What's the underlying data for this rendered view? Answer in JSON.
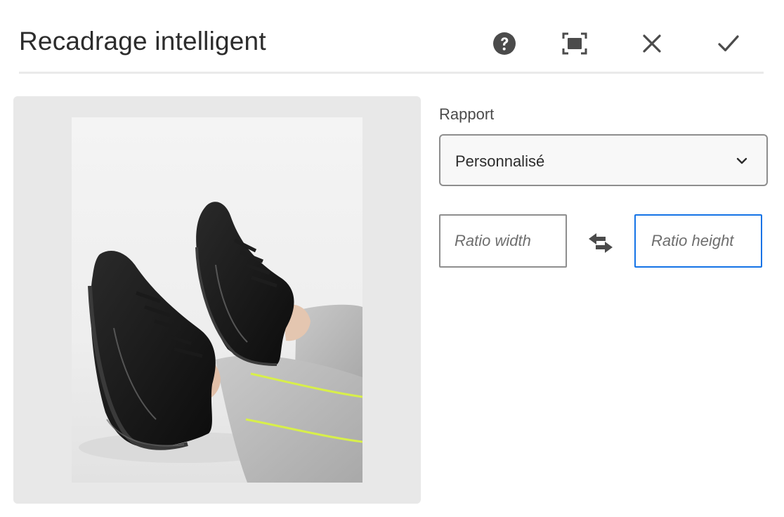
{
  "dialog": {
    "title": "Recadrage intelligent",
    "actions": {
      "help_icon": "help-circle-icon",
      "fullscreen_icon": "fullscreen-icon",
      "close_icon": "close-icon",
      "done_icon": "checkmark-icon"
    }
  },
  "preview": {
    "image_subject": "black-sneakers-photo"
  },
  "ratio": {
    "label": "Rapport",
    "selected": "Personnalisé",
    "width_placeholder": "Ratio width",
    "height_placeholder": "Ratio height",
    "width_value": "",
    "height_value": "",
    "swap_icon": "swap-arrows-icon"
  },
  "colors": {
    "accent": "#1473e6",
    "preview_bg": "#e8e8e8",
    "icon": "#4b4b4b"
  }
}
